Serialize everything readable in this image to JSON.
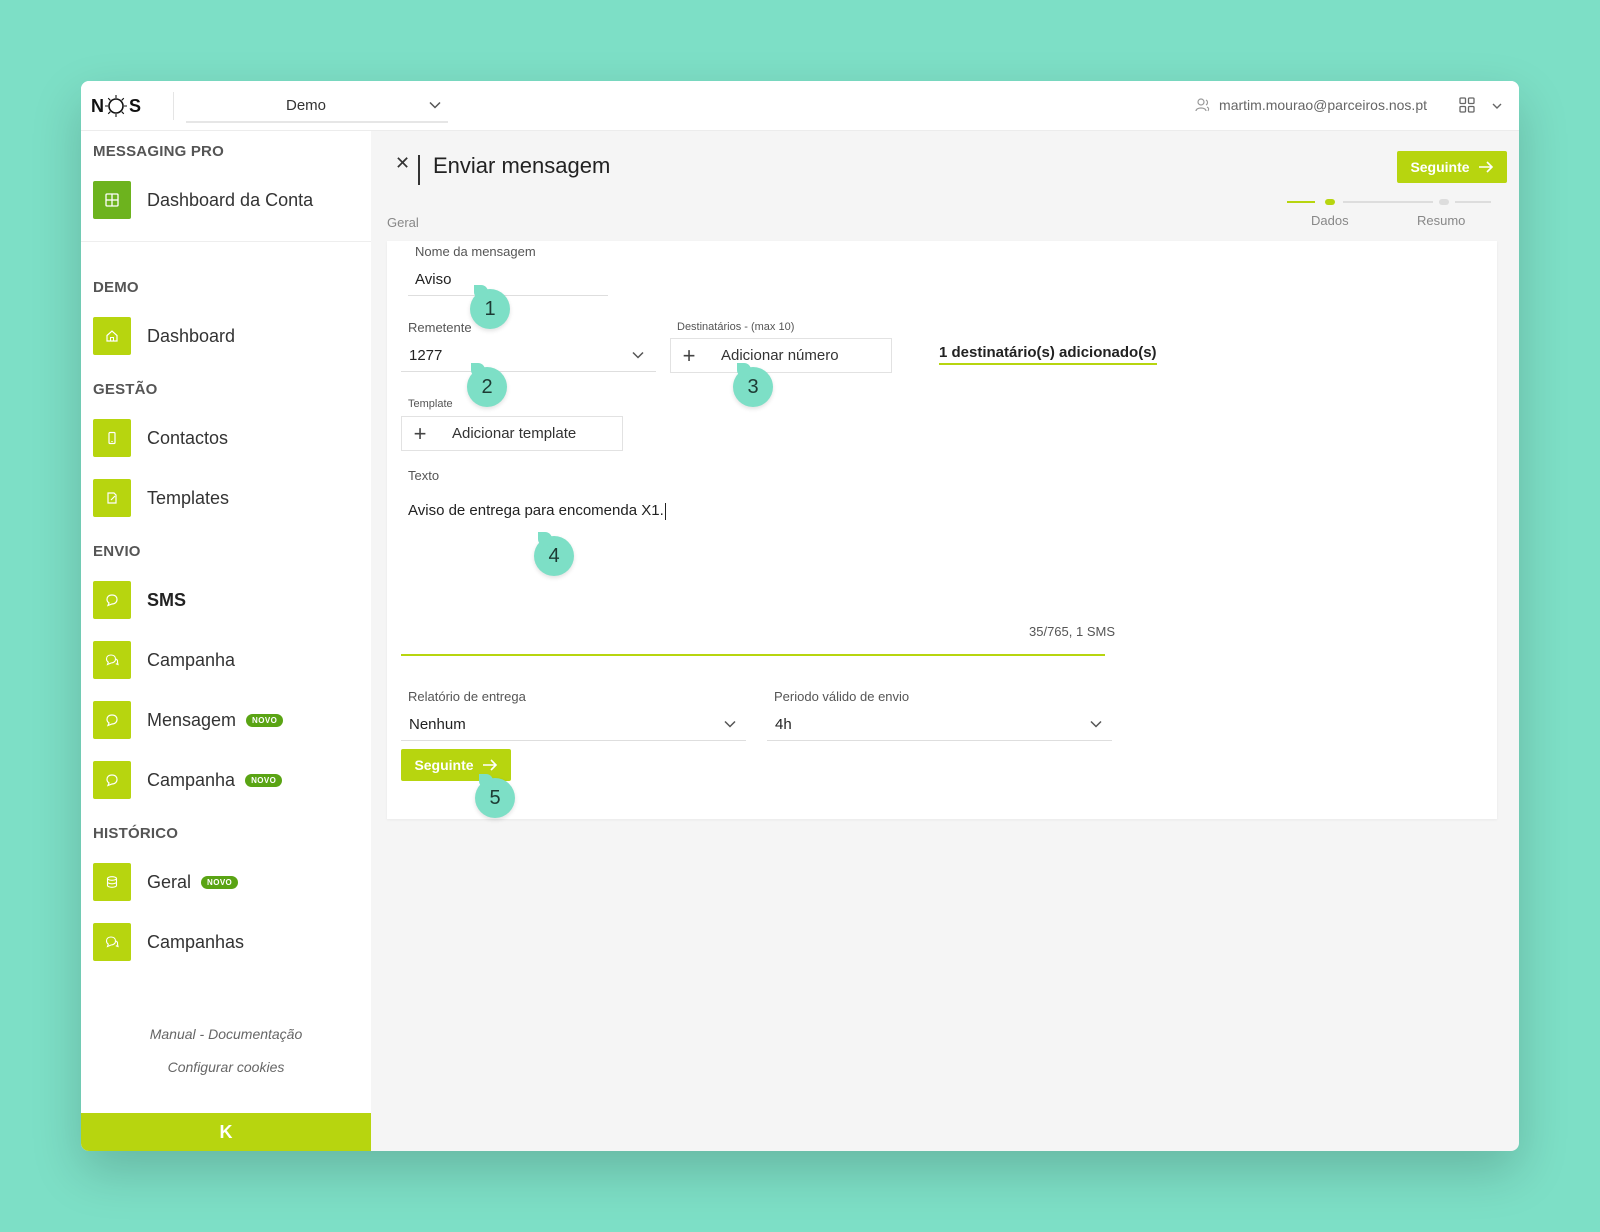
{
  "app": {
    "logo_text_left": "N",
    "logo_text_right": "S",
    "workspace": "Demo",
    "user_email": "martim.mourao@parceiros.nos.pt"
  },
  "sidebar": {
    "sections": {
      "messaging_pro": "MESSAGING PRO",
      "demo": "DEMO",
      "gestao": "GESTÃO",
      "envio": "ENVIO",
      "historico": "HISTÓRICO"
    },
    "items": [
      {
        "label": "Dashboard da Conta",
        "icon": "grid-icon"
      },
      {
        "label": "Dashboard",
        "icon": "home-icon"
      },
      {
        "label": "Contactos",
        "icon": "phone-icon"
      },
      {
        "label": "Templates",
        "icon": "edit-icon"
      },
      {
        "label": "SMS",
        "icon": "chat-icon"
      },
      {
        "label": "Campanha",
        "icon": "chat-multi-icon"
      },
      {
        "label": "Mensagem",
        "icon": "chat-icon",
        "badge": "NOVO"
      },
      {
        "label": "Campanha",
        "icon": "chat-icon",
        "badge": "NOVO"
      },
      {
        "label": "Geral",
        "icon": "database-icon",
        "badge": "NOVO"
      },
      {
        "label": "Campanhas",
        "icon": "chat-multi-icon"
      }
    ],
    "footer": {
      "manual": "Manual - Documentação",
      "cookies": "Configurar cookies",
      "collapse": "K"
    }
  },
  "main": {
    "title": "Enviar mensagem",
    "next_label": "Seguinte",
    "breadcrumb": "Geral",
    "steps": [
      "Dados",
      "Resumo"
    ],
    "form": {
      "name_label": "Nome da mensagem",
      "name_value": "Aviso",
      "sender_label": "Remetente",
      "sender_value": "1277",
      "recipients_label": "Destinatários - (max 10)",
      "add_number": "Adicionar número",
      "recipients_added": "1 destinatário(s) adicionado(s)",
      "template_label": "Template",
      "add_template": "Adicionar template",
      "text_label": "Texto",
      "text_value": "Aviso de entrega para encomenda X1.",
      "counter": "35/765, 1 SMS",
      "report_label": "Relatório de entrega",
      "report_value": "Nenhum",
      "period_label": "Periodo válido de envio",
      "period_value": "4h"
    }
  },
  "annotations": [
    "1",
    "2",
    "3",
    "4",
    "5"
  ],
  "colors": {
    "accent": "#b7d50f",
    "accent_dark": "#6db31e",
    "badge": "#5aa414",
    "annotation": "#7ddfc6",
    "background": "#7ddfc6"
  }
}
